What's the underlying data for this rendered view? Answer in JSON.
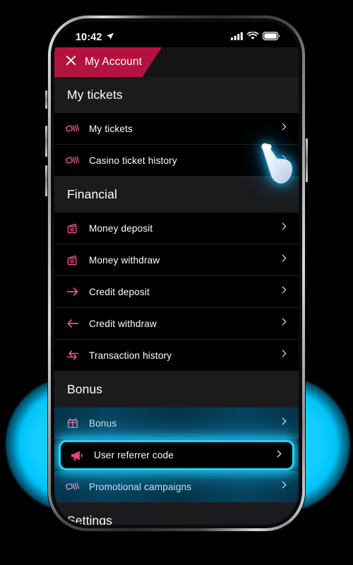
{
  "status_bar": {
    "time": "10:42",
    "location_icon": "location-arrow-icon",
    "signal_icon": "cellular-signal-icon",
    "wifi_icon": "wifi-icon",
    "battery_icon": "battery-full-icon"
  },
  "header": {
    "close_icon": "close-x-icon",
    "title": "My Account",
    "accent_color": "#b4133f"
  },
  "sections": [
    {
      "title": "My tickets",
      "rows": [
        {
          "label": "My tickets",
          "icon": "tickets-icon",
          "chevron": "chevron-right-icon"
        },
        {
          "label": "Casino ticket history",
          "icon": "tickets-icon",
          "chevron": "chevron-right-icon"
        }
      ]
    },
    {
      "title": "Financial",
      "rows": [
        {
          "label": "Money deposit",
          "icon": "wallet-icon",
          "chevron": "chevron-right-icon"
        },
        {
          "label": "Money withdraw",
          "icon": "wallet-icon",
          "chevron": "chevron-right-icon"
        },
        {
          "label": "Credit deposit",
          "icon": "arrow-right-icon",
          "chevron": "chevron-right-icon"
        },
        {
          "label": "Credit withdraw",
          "icon": "arrow-left-icon",
          "chevron": "chevron-right-icon"
        },
        {
          "label": "Transaction history",
          "icon": "arrows-exchange-icon",
          "chevron": "chevron-right-icon"
        }
      ]
    },
    {
      "title": "Bonus",
      "rows": [
        {
          "label": "Bonus",
          "icon": "gift-icon",
          "chevron": "chevron-right-icon"
        },
        {
          "label": "User referrer code",
          "icon": "megaphone-icon",
          "chevron": "chevron-right-icon"
        },
        {
          "label": "Promotional campaigns",
          "icon": "tickets-icon",
          "chevron": "chevron-right-icon"
        }
      ]
    },
    {
      "title": "Settings",
      "rows": []
    }
  ],
  "highlight": {
    "target_label": "User referrer code",
    "border_color": "#23d3ff",
    "cursor_icon": "pointing-hand-cursor-icon"
  },
  "glow": {
    "color": "#16cdff"
  },
  "icon_color": "#f0518f"
}
